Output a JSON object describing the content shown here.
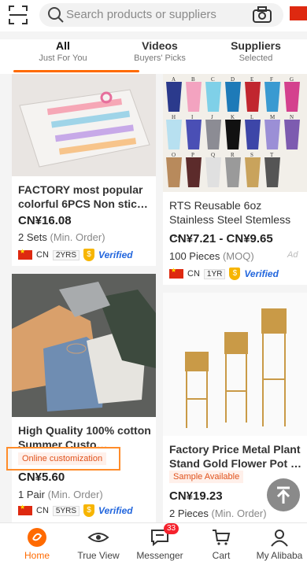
{
  "search": {
    "placeholder": "Search products or suppliers"
  },
  "tabs": [
    {
      "label": "All",
      "sub": "Just For You"
    },
    {
      "label": "Videos",
      "sub": "Buyers' Picks"
    },
    {
      "label": "Suppliers",
      "sub": "Selected"
    }
  ],
  "cards": [
    {
      "title": "FACTORY most popular colorful 6PCS Non stic…",
      "price": "CN¥16.08",
      "moq_qty": "2 Sets",
      "moq_unit": "(Min. Order)",
      "country": "CN",
      "years": "2YRS",
      "verified": "Verified"
    },
    {
      "title": "RTS Reusable 6oz Stainless Steel Stemless …",
      "price": "CN¥7.21 - CN¥9.65",
      "moq_qty": "100 Pieces",
      "moq_unit": "(MOQ)",
      "ad": "Ad",
      "country": "CN",
      "years": "1YR",
      "verified": "Verified"
    },
    {
      "title": "High Quality 100% cotton Summer Custo…",
      "badge": "Online customization",
      "price": "CN¥5.60",
      "moq_qty": "1 Pair",
      "moq_unit": "(Min. Order)",
      "country": "CN",
      "years": "5YRS",
      "verified": "Verified"
    },
    {
      "title": "Factory Price Metal Plant Stand Gold Flower Pot …",
      "badge": "Sample Available",
      "price": "CN¥19.23",
      "moq_qty": "2 Pieces",
      "moq_unit": "(Min. Order)"
    }
  ],
  "tumbler_letters": [
    "A",
    "B",
    "C",
    "D",
    "E",
    "F",
    "G",
    "H",
    "I",
    "J",
    "K",
    "L",
    "M",
    "N",
    "O",
    "P",
    "Q",
    "R",
    "S",
    "T"
  ],
  "nav": [
    {
      "label": "Home",
      "icon": "home-icon"
    },
    {
      "label": "True View",
      "icon": "eye-icon"
    },
    {
      "label": "Messenger",
      "icon": "messenger-icon",
      "badge": "33"
    },
    {
      "label": "Cart",
      "icon": "cart-icon"
    },
    {
      "label": "My Alibaba",
      "icon": "person-icon"
    }
  ],
  "colors": {
    "accent": "#ff6a00",
    "verified": "#2266dd"
  }
}
